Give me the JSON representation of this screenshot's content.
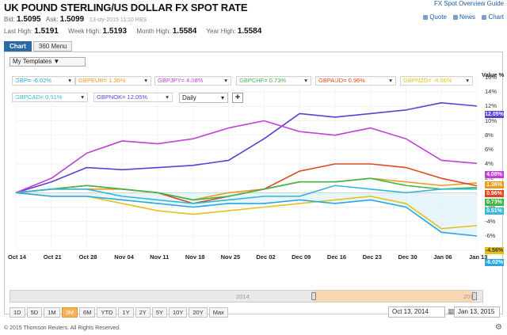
{
  "header": {
    "title": "UK POUND STERLING/US DOLLAR FX SPOT RATE",
    "overview_link": "FX Spot Overview Guide",
    "links": [
      "Quote",
      "News",
      "Chart"
    ]
  },
  "quote": {
    "bid_label": "Bid:",
    "bid": "1.5095",
    "ask_label": "Ask:",
    "ask": "1.5099",
    "timestamp": "13-sty-2015  11:10 RBS"
  },
  "highs": {
    "last_label": "Last High:",
    "last": "1.5191",
    "week_label": "Week High:",
    "week": "1.5193",
    "month_label": "Month High:",
    "month": "1.5584",
    "year_label": "Year High:",
    "year": "1.5584"
  },
  "tabs": [
    "Chart",
    "360 Menu"
  ],
  "toolbar": {
    "templates": "My Templates ▼",
    "interval": "Daily",
    "add": "+",
    "value_label": "Value %"
  },
  "legend": [
    {
      "label": "GBP= -6.02%",
      "color": "#29a7e0"
    },
    {
      "label": "GBPEUR= 1.36%",
      "color": "#f09a1a"
    },
    {
      "label": "GBPJPY= 4.08%",
      "color": "#c23fd9"
    },
    {
      "label": "GBPCHF= 0.73%",
      "color": "#3fb64a"
    },
    {
      "label": "GBPAUD= 0.96%",
      "color": "#e0461e"
    },
    {
      "label": "GBPNZD= -4.56%",
      "color": "#e6c11a"
    },
    {
      "label": "GBPCAD= 0.51%",
      "color": "#35b7d6"
    },
    {
      "label": "GBPNOK= 12.05%",
      "color": "#5b3fd8"
    }
  ],
  "y_ticks": [
    "16%",
    "14%",
    "12%",
    "10%",
    "8%",
    "6%",
    "4%",
    "2%",
    "0%",
    "-2%",
    "-4%",
    "-6%",
    "-8%"
  ],
  "x_ticks": [
    "Oct 14",
    "Oct 21",
    "Oct 28",
    "Nov 04",
    "Nov 11",
    "Nov 18",
    "Nov 25",
    "Dec 02",
    "Dec 09",
    "Dec 16",
    "Dec 23",
    "Dec 30",
    "Jan 06",
    "Jan 13"
  ],
  "end_badges": [
    {
      "text": "12.05%",
      "bg": "#5b3fd8"
    },
    {
      "text": "4.08%",
      "bg": "#c23fd9"
    },
    {
      "text": "1.36%",
      "bg": "#f09a1a"
    },
    {
      "text": "0.96%",
      "bg": "#e0461e"
    },
    {
      "text": "0.73%",
      "bg": "#3fb64a"
    },
    {
      "text": "0.51%",
      "bg": "#35b7d6"
    },
    {
      "text": "-4.56%",
      "bg": "#e6c11a"
    },
    {
      "text": "-6.02%",
      "bg": "#29a7e0"
    }
  ],
  "navigator": {
    "year_left": "2014",
    "year_right": "2015"
  },
  "ranges": [
    "1D",
    "5D",
    "1M",
    "3M",
    "6M",
    "YTD",
    "1Y",
    "2Y",
    "5Y",
    "10Y",
    "20Y",
    "Max"
  ],
  "active_range": "3M",
  "date_from": "Oct 13, 2014",
  "date_to": "Jan 13, 2015",
  "footer": "© 2015 Thomson Reuters. All Rights Reserved.",
  "chart_data": {
    "type": "line",
    "ylabel": "Value %",
    "ylim": [
      -8,
      16
    ],
    "x": [
      "Oct 14",
      "Oct 21",
      "Oct 28",
      "Nov 04",
      "Nov 11",
      "Nov 18",
      "Nov 25",
      "Dec 02",
      "Dec 09",
      "Dec 16",
      "Dec 23",
      "Dec 30",
      "Jan 06",
      "Jan 13"
    ],
    "series": [
      {
        "name": "GBPNOK",
        "color": "#5b3fd8",
        "values": [
          0,
          1.5,
          3.5,
          3.2,
          3.5,
          3.8,
          4.5,
          7.5,
          11.0,
          10.5,
          11.0,
          11.5,
          12.5,
          12.05
        ]
      },
      {
        "name": "GBPJPY",
        "color": "#c23fd9",
        "values": [
          0,
          2.0,
          5.5,
          7.2,
          6.8,
          7.5,
          9.0,
          10.0,
          8.5,
          8.0,
          9.0,
          7.5,
          4.5,
          4.08
        ]
      },
      {
        "name": "GBPEUR",
        "color": "#f09a1a",
        "values": [
          0,
          0.5,
          0.5,
          0.5,
          0,
          -1.0,
          0,
          0.5,
          1.5,
          1.5,
          2.0,
          1.5,
          1.0,
          1.36
        ]
      },
      {
        "name": "GBPAUD",
        "color": "#e0461e",
        "values": [
          0,
          0.5,
          1.0,
          0.5,
          0,
          -1.5,
          -0.5,
          0.5,
          3.0,
          4.0,
          4.0,
          3.5,
          2.0,
          0.96
        ]
      },
      {
        "name": "GBPCHF",
        "color": "#3fb64a",
        "values": [
          0,
          0.5,
          1.0,
          0.5,
          0,
          -1.0,
          -0.5,
          0.5,
          1.5,
          1.5,
          2.0,
          1.0,
          0.5,
          0.73
        ]
      },
      {
        "name": "GBPCAD",
        "color": "#35b7d6",
        "values": [
          0,
          0.5,
          0.5,
          -0.5,
          -1.0,
          -1.5,
          -1.0,
          -0.5,
          -0.5,
          1.0,
          0.5,
          0,
          0.5,
          0.51
        ]
      },
      {
        "name": "GBPNZD",
        "color": "#e6c11a",
        "values": [
          0,
          -0.5,
          -0.5,
          -1.5,
          -2.5,
          -3.0,
          -2.5,
          -2.0,
          -1.5,
          -1.0,
          -0.5,
          -1.5,
          -5.0,
          -4.56
        ]
      },
      {
        "name": "GBP",
        "color": "#29a7e0",
        "values": [
          0,
          -0.5,
          -0.5,
          -1.0,
          -1.5,
          -2.0,
          -1.5,
          -1.5,
          -1.0,
          -1.5,
          -1.0,
          -2.0,
          -5.5,
          -6.02
        ]
      }
    ]
  }
}
